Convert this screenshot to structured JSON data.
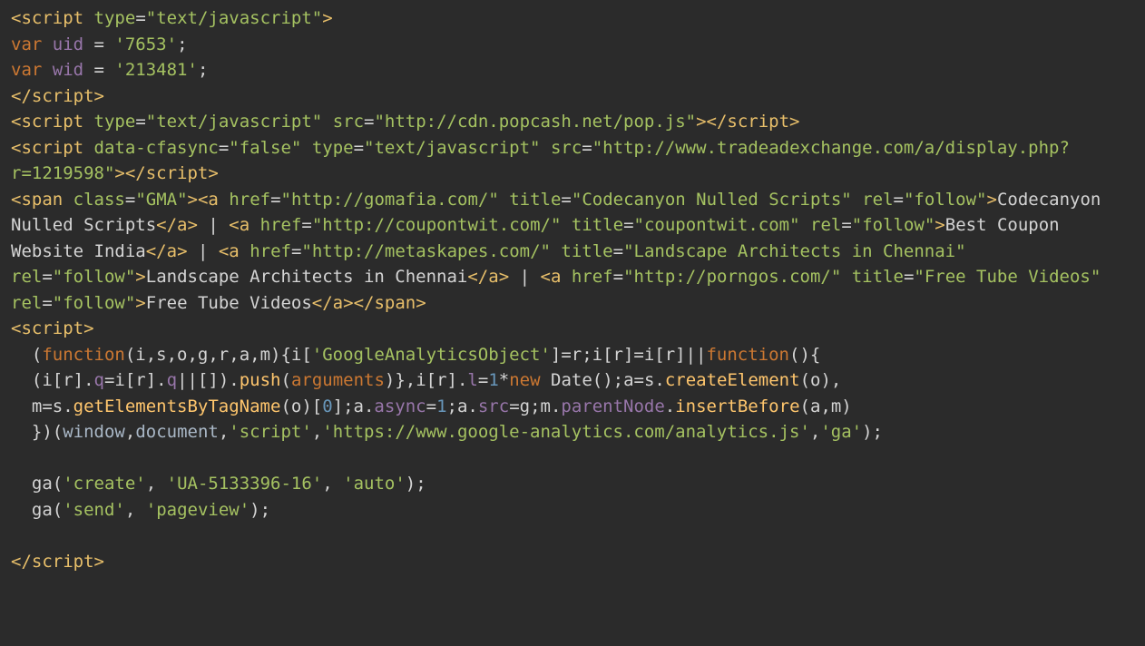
{
  "lines": {
    "l1_open": "<",
    "l1_script": "script",
    "l1_sp": " ",
    "l1_type_attr": "type",
    "l1_eq": "=",
    "l1_type_val": "\"text/javascript\"",
    "l1_close": ">",
    "l2_var": "var",
    "l2_u": " uid ",
    "l2_eq": "= ",
    "l2_val": "'7653'",
    "l2_end": ";",
    "l3_var": "var",
    "l3_w": " wid ",
    "l3_eq": "= ",
    "l3_val": "'213481'",
    "l3_end": ";",
    "l4_open": "</",
    "l4_script": "script",
    "l4_close": ">",
    "l5_open": "<",
    "l5_script": "script",
    "l5_sp1": " ",
    "l5_type_attr": "type",
    "l5_eq1": "=",
    "l5_type_val": "\"text/javascript\"",
    "l5_sp2": " ",
    "l5_src_attr": "src",
    "l5_eq2": "=",
    "l5_src_val": "\"http://cdn.popcash.net/pop.js\"",
    "l5_mid": "></",
    "l5_script2": "script",
    "l5_close": ">",
    "l6_open": "<",
    "l6_script": "script",
    "l6_sp1": " ",
    "l6_cf_attr": "data-cfasync",
    "l6_eq1": "=",
    "l6_cf_val": "\"false\"",
    "l6_sp2": " ",
    "l6_type_attr": "type",
    "l6_eq2": "=",
    "l6_type_val": "\"text/javascript\"",
    "l6_sp3": " ",
    "l6_src_attr": "src",
    "l6_eq3": "=",
    "l6_src_val": "\"http://www.tradeadexchange.com/a/display.php?r=1219598\"",
    "l6_mid": "></",
    "l6_script2": "script",
    "l6_close": ">",
    "l7_open": "<",
    "l7_span": "span",
    "l7_sp": " ",
    "l7_class_attr": "class",
    "l7_eq": "=",
    "l7_class_val": "\"GMA\"",
    "l7_close": "><",
    "l7_a": "a",
    "l7_sp2": " ",
    "l7_href_attr": "href",
    "l7_eq2": "=",
    "l7_href_val": "\"http://gomafia.com/\"",
    "l7_sp3": " ",
    "l7_title_attr": "title",
    "l7_eq3": "=",
    "l7_title_val": "\"Codecanyon Nulled Scripts\"",
    "l7_sp4": " ",
    "l7_rel_attr": "rel",
    "l7_eq4": "=",
    "l7_rel_val": "\"follow\"",
    "l7_close2": ">",
    "l7_text1": "Codecanyon Nulled Scripts",
    "l7_ca": "</",
    "l7_a2": "a",
    "l7_close3": ">",
    "l7_pipe1": " | ",
    "l7_oa2": "<",
    "l7_a3": "a",
    "l7_sp5": " ",
    "l7_href_attr2": "href",
    "l7_eq5": "=",
    "l7_href_val2": "\"http://coupontwit.com/\"",
    "l7_sp6": " ",
    "l7_title_attr2": "title",
    "l7_eq6": "=",
    "l7_title_val2": "\"coupontwit.com\"",
    "l7_sp7": " ",
    "l7_rel_attr2": "rel",
    "l7_eq7": "=",
    "l7_rel_val2": "\"follow\"",
    "l7_close4": ">",
    "l7_text2": "Best Coupon Website India",
    "l7_ca2": "</",
    "l7_a4": "a",
    "l7_close5": ">",
    "l7_pipe2": " | ",
    "l7_oa3": "<",
    "l7_a5": "a",
    "l7_sp8": " ",
    "l7_href_attr3": "href",
    "l7_eq8": "=",
    "l7_href_val3": "\"http://metaskapes.com/\"",
    "l7_sp9": " ",
    "l7_title_attr3": "title",
    "l7_eq9": "=",
    "l7_title_val3": "\"Landscape Architects in Chennai\"",
    "l7_sp10": " ",
    "l7_rel_attr3": "rel",
    "l7_eq10": "=",
    "l7_rel_val3": "\"follow\"",
    "l7_close6": ">",
    "l7_text3": "Landscape Architects in Chennai",
    "l7_ca3": "</",
    "l7_a6": "a",
    "l7_close7": ">",
    "l7_pipe3": " | ",
    "l7_oa4": "<",
    "l7_a7": "a",
    "l7_sp11": " ",
    "l7_href_attr4": "href",
    "l7_eq11": "=",
    "l7_href_val4": "\"http://porngos.com/\"",
    "l7_sp12": " ",
    "l7_title_attr4": "title",
    "l7_eq12": "=",
    "l7_title_val4": "\"Free Tube Videos\"",
    "l7_sp13": " ",
    "l7_rel_attr4": "rel",
    "l7_eq13": "=",
    "l7_rel_val4": "\"follow\"",
    "l7_close8": ">",
    "l7_text4": "Free Tube Videos",
    "l7_ca4": "</",
    "l7_a8": "a",
    "l7_close9": "></",
    "l7_span2": "span",
    "l7_close10": ">",
    "l8_open": "<",
    "l8_script": "script",
    "l8_close": ">",
    "l9_indent": "  (",
    "l9_fn": "function",
    "l9_params": "(i,s,o,g,r,a,m)",
    "l9_body1": "{i[",
    "l9_ga_str": "'GoogleAnalyticsObject'",
    "l9_body2": "]=r;i[r]=i[r]||",
    "l9_fn2": "function",
    "l9_body3": "(){",
    "l10_indent": "  ",
    "l10_body1": "(i[r].",
    "l10_q": "q",
    "l10_body2": "=i[r].",
    "l10_q2": "q",
    "l10_body3": "||[]).",
    "l10_push": "push",
    "l10_body4": "(",
    "l10_args": "arguments",
    "l10_body5": ")},i[r].",
    "l10_l": "l",
    "l10_body6": "=",
    "l10_one": "1",
    "l10_body7": "*",
    "l10_new": "new",
    "l10_sp": " ",
    "l10_date": "Date",
    "l10_body8": "();a=s.",
    "l10_create": "createElement",
    "l10_body9": "(o),",
    "l11_indent": "  ",
    "l11_body1": "m=s.",
    "l11_get": "getElementsByTagName",
    "l11_body2": "(o)[",
    "l11_zero": "0",
    "l11_body3": "];a.",
    "l11_async": "async",
    "l11_body4": "=",
    "l11_one": "1",
    "l11_body5": ";a.",
    "l11_src": "src",
    "l11_body6": "=g;m.",
    "l11_pn": "parentNode",
    "l11_body7": ".",
    "l11_ib": "insertBefore",
    "l11_body8": "(a,m)",
    "l12_indent": "  ",
    "l12_body1": "})(",
    "l12_win": "window",
    "l12_c1": ",",
    "l12_doc": "document",
    "l12_c2": ",",
    "l12_s1": "'script'",
    "l12_c3": ",",
    "l12_s2": "'https://www.google-analytics.com/analytics.js'",
    "l12_c4": ",",
    "l12_s3": "'ga'",
    "l12_body2": ");",
    "l13_indent": "  ",
    "l13_ga": "ga",
    "l13_open": "(",
    "l13_s1": "'create'",
    "l13_c1": ", ",
    "l13_s2": "'UA-5133396-16'",
    "l13_c2": ", ",
    "l13_s3": "'auto'",
    "l13_close": ");",
    "l14_indent": "  ",
    "l14_ga": "ga",
    "l14_open": "(",
    "l14_s1": "'send'",
    "l14_c1": ", ",
    "l14_s2": "'pageview'",
    "l14_close": ");",
    "l15_open": "</",
    "l15_script": "script",
    "l15_close": ">"
  }
}
